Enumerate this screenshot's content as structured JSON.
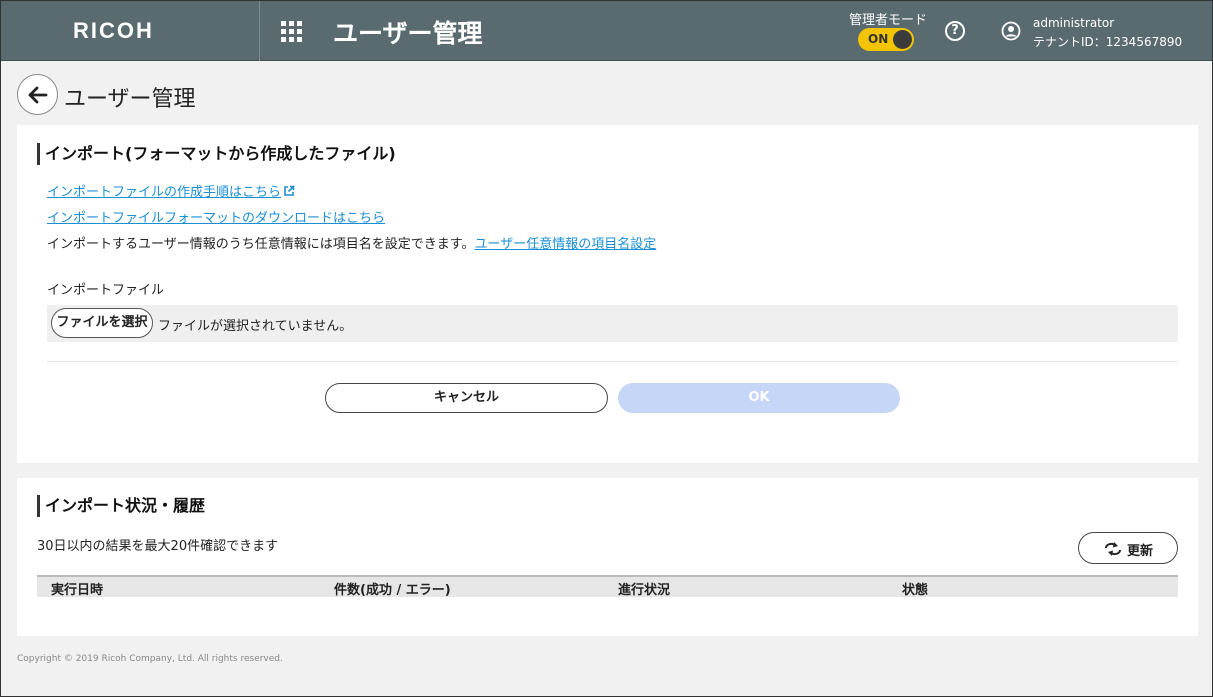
{
  "header": {
    "logo": "RICOH",
    "title": "ユーザー管理",
    "admin_mode_label": "管理者モード",
    "toggle_label": "ON",
    "help_symbol": "?",
    "user_name": "administrator",
    "tenant": "テナントID：1234567890"
  },
  "page": {
    "title": "ユーザー管理"
  },
  "import_section": {
    "title": "インポート(フォーマットから作成したファイル)",
    "link_procedure": "インポートファイルの作成手順はこちら",
    "link_format_download": "インポートファイルフォーマットのダウンロードはこちら",
    "info_text": "インポートするユーザー情報のうち任意情報には項目名を設定できます。",
    "info_link": "ユーザー任意情報の項目名設定",
    "file_label": "インポートファイル",
    "choose_file_button": "ファイルを選択",
    "file_status": "ファイルが選択されていません。",
    "cancel_button": "キャンセル",
    "ok_button": "OK"
  },
  "history_section": {
    "title": "インポート状況・履歴",
    "note": "30日以内の結果を最大20件確認できます",
    "refresh_button": "更新",
    "columns": [
      "実行日時",
      "件数(成功 / エラー)",
      "進行状況",
      "状態"
    ]
  },
  "footer": {
    "copyright": "Copyright © 2019 Ricoh Company, Ltd. All rights reserved."
  },
  "colors": {
    "header_bg": "#5a6b70",
    "toggle_on": "#f5c400",
    "link": "#1a8fd6",
    "ok_disabled": "#c5d6f7"
  },
  "icons": {
    "apps": "apps-grid-icon",
    "help": "help-icon",
    "user": "user-circle-icon",
    "back": "arrow-left-icon",
    "external": "external-link-icon",
    "refresh": "refresh-icon"
  }
}
